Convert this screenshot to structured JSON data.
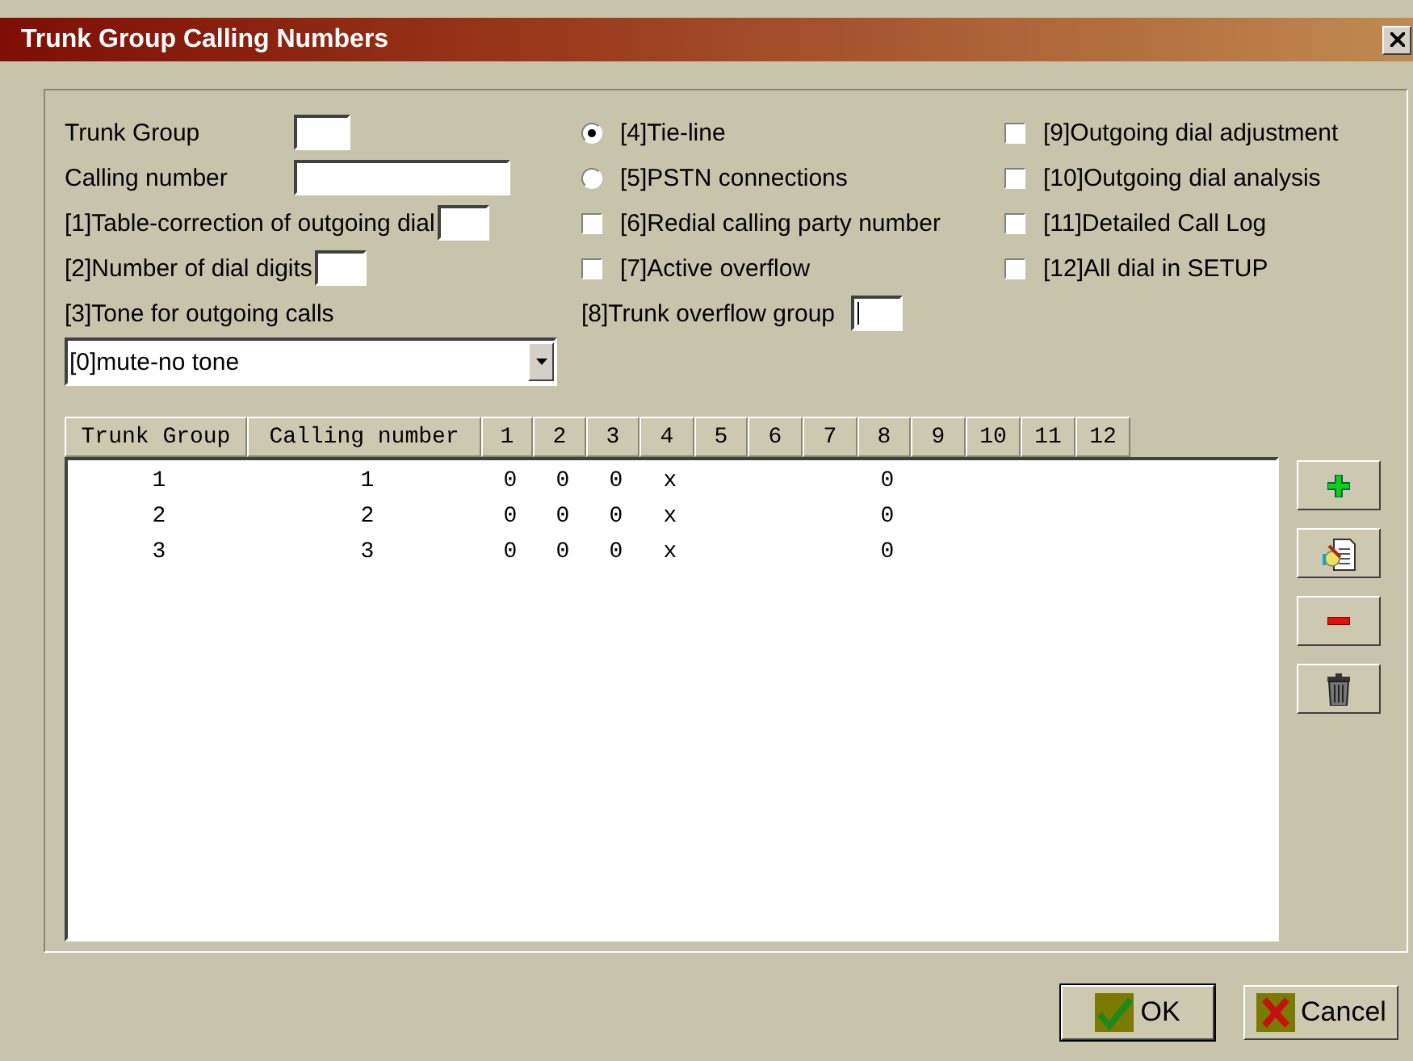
{
  "window": {
    "title": "Trunk Group Calling Numbers"
  },
  "trunk_group": {
    "label": "Trunk Group"
  },
  "calling_number": {
    "label": "Calling number"
  },
  "table_correction": {
    "label": "[1]Table-correction of outgoing dial"
  },
  "dial_digits": {
    "label": "[2]Number of dial digits"
  },
  "tone": {
    "label": "[3]Tone for outgoing calls",
    "value": "[0]mute-no tone"
  },
  "line_type": [
    {
      "label": "[4]Tie-line",
      "selected": true
    },
    {
      "label": "[5]PSTN connections",
      "selected": false
    }
  ],
  "options": [
    {
      "label": "[6]Redial calling party number",
      "checked": false
    },
    {
      "label": "[7]Active overflow",
      "checked": false
    }
  ],
  "overflow_group": {
    "label": "[8]Trunk overflow group"
  },
  "options_right": [
    {
      "label": "[9]Outgoing dial adjustment",
      "checked": false
    },
    {
      "label": "[10]Outgoing dial analysis",
      "checked": false
    },
    {
      "label": "[11]Detailed Call Log",
      "checked": false
    },
    {
      "label": "[12]All dial in SETUP",
      "checked": false
    }
  ],
  "table": {
    "columns": [
      "Trunk Group",
      "Calling number",
      "1",
      "2",
      "3",
      "4",
      "5",
      "6",
      "7",
      "8",
      "9",
      "10",
      "11",
      "12"
    ],
    "rows": [
      [
        "1",
        "1",
        "0",
        "0",
        "0",
        "x",
        null,
        null,
        null,
        "0",
        null,
        null,
        null,
        null
      ],
      [
        "2",
        "2",
        "0",
        "0",
        "0",
        "x",
        null,
        null,
        null,
        "0",
        null,
        null,
        null,
        null
      ],
      [
        "3",
        "3",
        "0",
        "0",
        "0",
        "x",
        null,
        null,
        null,
        "0",
        null,
        null,
        null,
        null
      ]
    ]
  },
  "buttons": [
    {
      "label": "OK",
      "kind": "ok"
    },
    {
      "label": "Cancel",
      "kind": "cancel"
    }
  ]
}
